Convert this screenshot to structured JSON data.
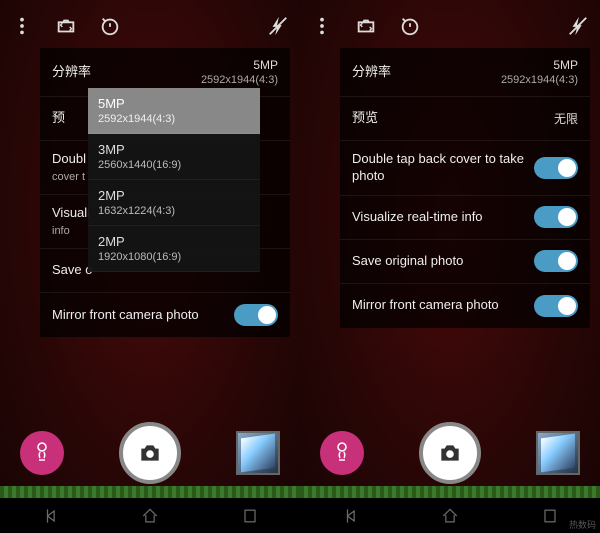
{
  "left": {
    "resolution_label": "分辨率",
    "resolution_value": "5MP",
    "resolution_sub": "2592x1944(4:3)",
    "preview_label": "预",
    "double_tap_label": "Doubl",
    "double_tap_sub": "cover t",
    "visualize_label": "Visuali",
    "visualize_sub": "info",
    "save_label": "Save o",
    "mirror_label": "Mirror front camera photo"
  },
  "dropdown": [
    {
      "title": "5MP",
      "sub": "2592x1944(4:3)",
      "selected": true
    },
    {
      "title": "3MP",
      "sub": "2560x1440(16:9)",
      "selected": false
    },
    {
      "title": "2MP",
      "sub": "1632x1224(4:3)",
      "selected": false
    },
    {
      "title": "2MP",
      "sub": "1920x1080(16:9)",
      "selected": false
    }
  ],
  "right": {
    "resolution_label": "分辨率",
    "resolution_value": "5MP",
    "resolution_sub": "2592x1944(4:3)",
    "preview_label": "预览",
    "preview_value": "无限",
    "double_tap_label": "Double tap back cover to take photo",
    "visualize_label": "Visualize real-time info",
    "save_label": "Save original photo",
    "mirror_label": "Mirror front camera photo"
  },
  "watermark": "热数码"
}
